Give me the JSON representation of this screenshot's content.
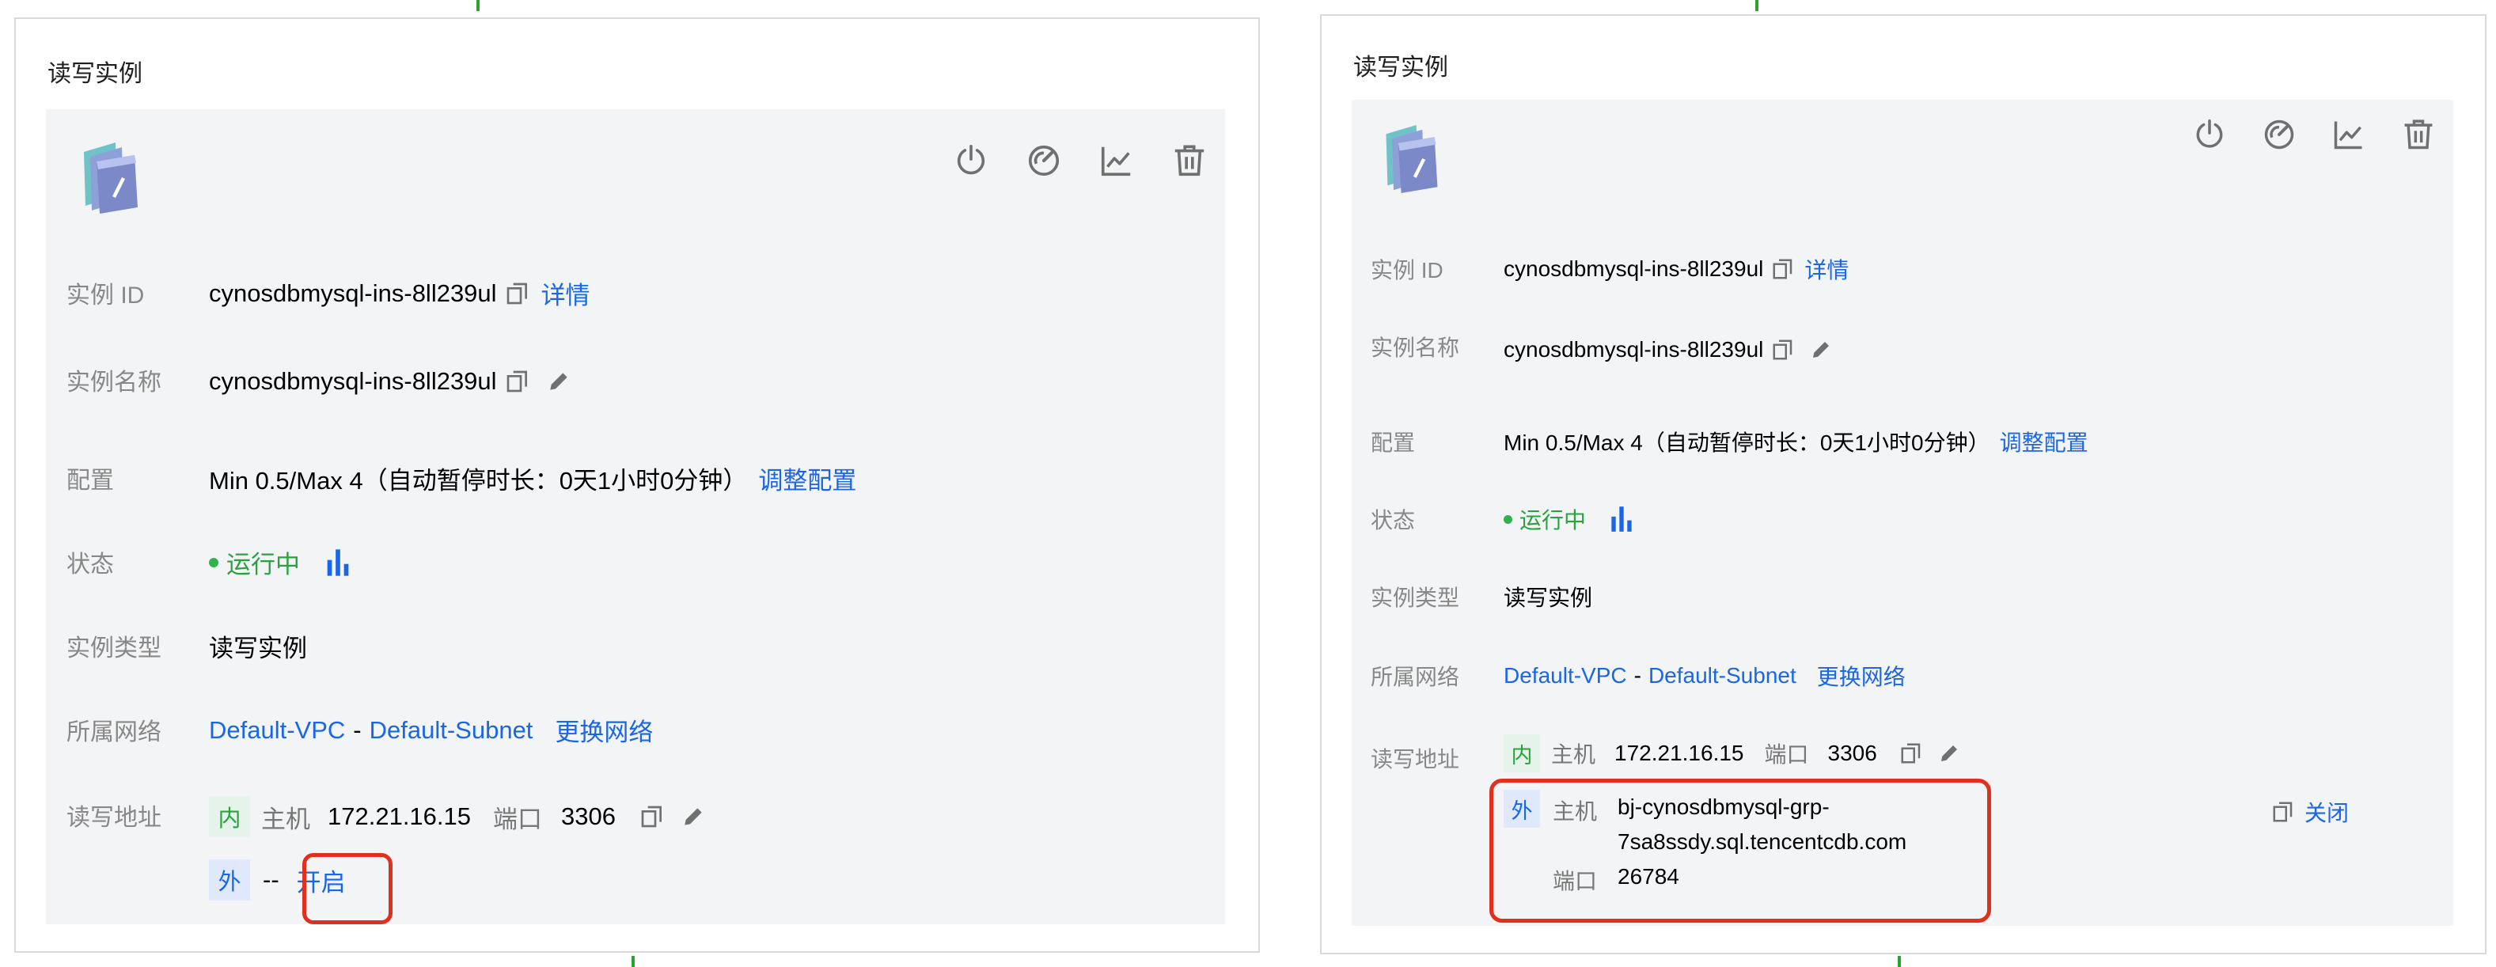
{
  "left": {
    "title": "读写实例",
    "fields": {
      "instance_id": {
        "label": "实例 ID",
        "value": "cynosdbmysql-ins-8ll239ul",
        "detail_link": "详情"
      },
      "instance_name": {
        "label": "实例名称",
        "value": "cynosdbmysql-ins-8ll239ul"
      },
      "config": {
        "label": "配置",
        "value": "Min 0.5/Max 4（自动暂停时长：0天1小时0分钟）",
        "adjust_link": "调整配置"
      },
      "status": {
        "label": "状态",
        "value": "运行中"
      },
      "instance_type": {
        "label": "实例类型",
        "value": "读写实例"
      },
      "network": {
        "label": "所属网络",
        "vpc": "Default-VPC",
        "separator": "-",
        "subnet": "Default-Subnet",
        "change_link": "更换网络"
      },
      "address": {
        "label": "读写地址",
        "internal_tag": "内",
        "host_label": "主机",
        "host": "172.21.16.15",
        "port_label": "端口",
        "port": "3306",
        "external_tag": "外",
        "external_value": "--",
        "enable_link": "开启"
      }
    }
  },
  "right": {
    "title": "读写实例",
    "fields": {
      "instance_id": {
        "label": "实例 ID",
        "value": "cynosdbmysql-ins-8ll239ul",
        "detail_link": "详情"
      },
      "instance_name": {
        "label": "实例名称",
        "value": "cynosdbmysql-ins-8ll239ul"
      },
      "config": {
        "label": "配置",
        "value": "Min 0.5/Max 4（自动暂停时长：0天1小时0分钟）",
        "adjust_link": "调整配置"
      },
      "status": {
        "label": "状态",
        "value": "运行中"
      },
      "instance_type": {
        "label": "实例类型",
        "value": "读写实例"
      },
      "network": {
        "label": "所属网络",
        "vpc": "Default-VPC",
        "separator": "-",
        "subnet": "Default-Subnet",
        "change_link": "更换网络"
      },
      "address": {
        "label": "读写地址",
        "internal_tag": "内",
        "host_label": "主机",
        "host": "172.21.16.15",
        "port_label": "端口",
        "port": "3306",
        "external_tag": "外",
        "external_host_label": "主机",
        "external_host_line1": "bj-cynosdbmysql-grp-",
        "external_host_line2": "7sa8ssdy.sql.tencentcdb.com",
        "external_port_label": "端口",
        "external_port": "26784",
        "close_link": "关闭"
      }
    }
  },
  "icons": [
    "power-icon",
    "gauge-icon",
    "monitor-chart-icon",
    "delete-icon",
    "instance-logo-icon",
    "copy-icon",
    "edit-icon",
    "bar-chart-icon"
  ],
  "colors": {
    "link": "#1a66e8",
    "running": "#29a33d",
    "highlight_box": "#e0301e",
    "card_bg": "#f3f4f6"
  }
}
